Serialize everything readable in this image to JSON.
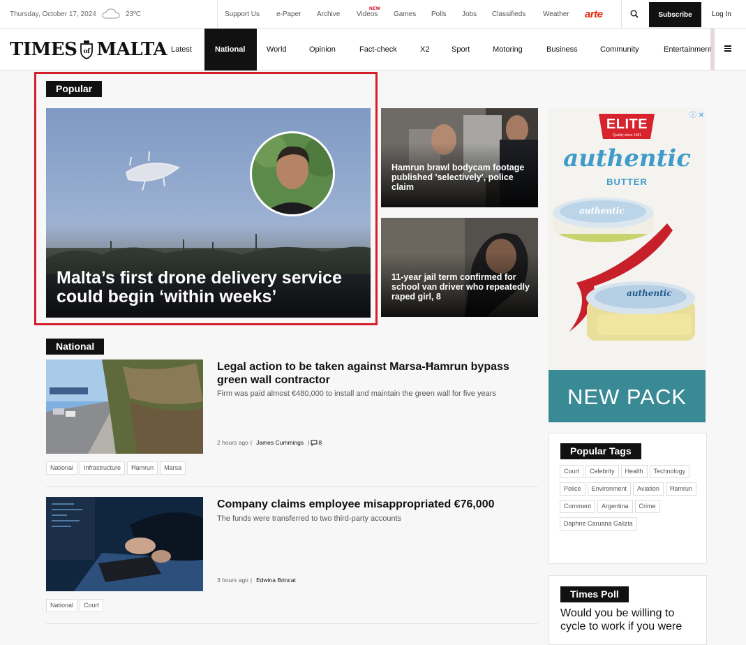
{
  "topbar": {
    "date": "Thursday, October 17, 2024",
    "weather_icon": "cloud-icon",
    "temperature": "23ºC",
    "links": [
      "Support Us",
      "e-Paper",
      "Archive",
      "Videos",
      "Games",
      "Polls",
      "Jobs",
      "Classifieds",
      "Weather"
    ],
    "videos_badge": "NEW",
    "partner_logo": "arte",
    "subscribe_label": "Subscribe",
    "login_label": "Log In"
  },
  "header": {
    "logo_left": "TIMES",
    "logo_right": "MALTA",
    "nav": [
      "Latest",
      "National",
      "World",
      "Opinion",
      "Fact-check",
      "X2",
      "Sport",
      "Motoring",
      "Business",
      "Community",
      "Entertainment"
    ],
    "active_nav": "National"
  },
  "popular": {
    "section_label": "Popular",
    "hero_title": "Malta’s first drone delivery service could begin ‘within weeks’",
    "tiles": [
      {
        "title": "Hamrun brawl bodycam footage published 'selectively', police claim"
      },
      {
        "title": "11-year jail term confirmed for school van driver who repeatedly raped girl, 8"
      }
    ]
  },
  "national": {
    "section_label": "National",
    "articles": [
      {
        "headline": "Legal action to be taken against Marsa-Ħamrun bypass green wall contractor",
        "dek": "Firm was paid almost €480,000 to install and maintain the green wall for five years",
        "time": "2 hours ago",
        "author": "James Cummings",
        "comments": "8",
        "tags": [
          "National",
          "Infrastructure",
          "Ħamrun",
          "Marsa"
        ]
      },
      {
        "headline": "Company claims employee misappropriated €76,000",
        "dek": "The funds were transferred to two third-party accounts",
        "time": "3 hours ago",
        "author": "Edwina Brincat",
        "tags": [
          "National",
          "Court"
        ]
      }
    ]
  },
  "ad": {
    "brand": "ELITE",
    "brand_sub": "Quality since 1961",
    "product": "authentic",
    "product_sub": "BUTTER",
    "pack_label": "authentic",
    "cta": "NEW PACK",
    "colors": {
      "brand_red": "#d6232d",
      "teal": "#3a8a95"
    }
  },
  "popular_tags": {
    "title": "Popular Tags",
    "tags": [
      "Court",
      "Celebrity",
      "Health",
      "Technology",
      "Police",
      "Environment",
      "Aviation",
      "Ħamrun",
      "Comment",
      "Argentina",
      "Crime",
      "Daphne Caruana Galizia"
    ]
  },
  "poll": {
    "title": "Times Poll",
    "question": "Would you be willing to cycle to work if you were"
  }
}
